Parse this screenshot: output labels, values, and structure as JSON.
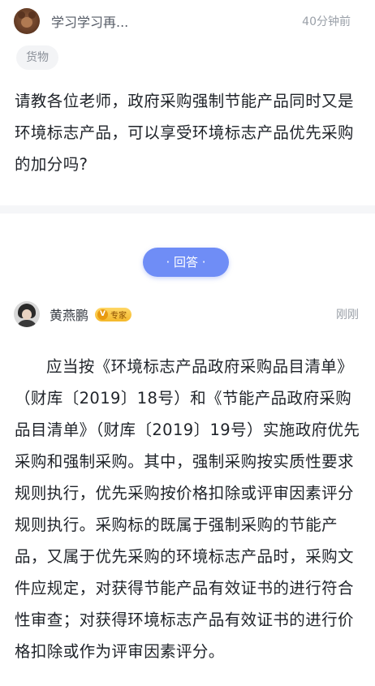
{
  "question": {
    "author": "学习学习再...",
    "time": "40分钟前",
    "tag": "货物",
    "text": "请教各位老师，政府采购强制节能产品同时又是环境标志产品，可以享受环境标志产品优先采购的加分吗?"
  },
  "answer_section": {
    "label": "· 回答 ·"
  },
  "answer": {
    "author": "黄燕鹏",
    "badge_icon": "V",
    "badge_text": "专家",
    "time": "刚刚",
    "text": "应当按《环境标志产品政府采购品目清单》（财库〔2019〕18号）和《节能产品政府采购品目清单》（财库〔2019〕19号）实施政府优先采购和强制采购。其中，强制采购按实质性要求规则执行，优先采购按价格扣除或评审因素评分规则执行。采购标的既属于强制采购的节能产品，又属于优先采购的环境标志产品时，采购文件应规定，对获得节能产品有效证书的进行符合性审查；对获得环境标志产品有效证书的进行价格扣除或作为评审因素评分。"
  }
}
